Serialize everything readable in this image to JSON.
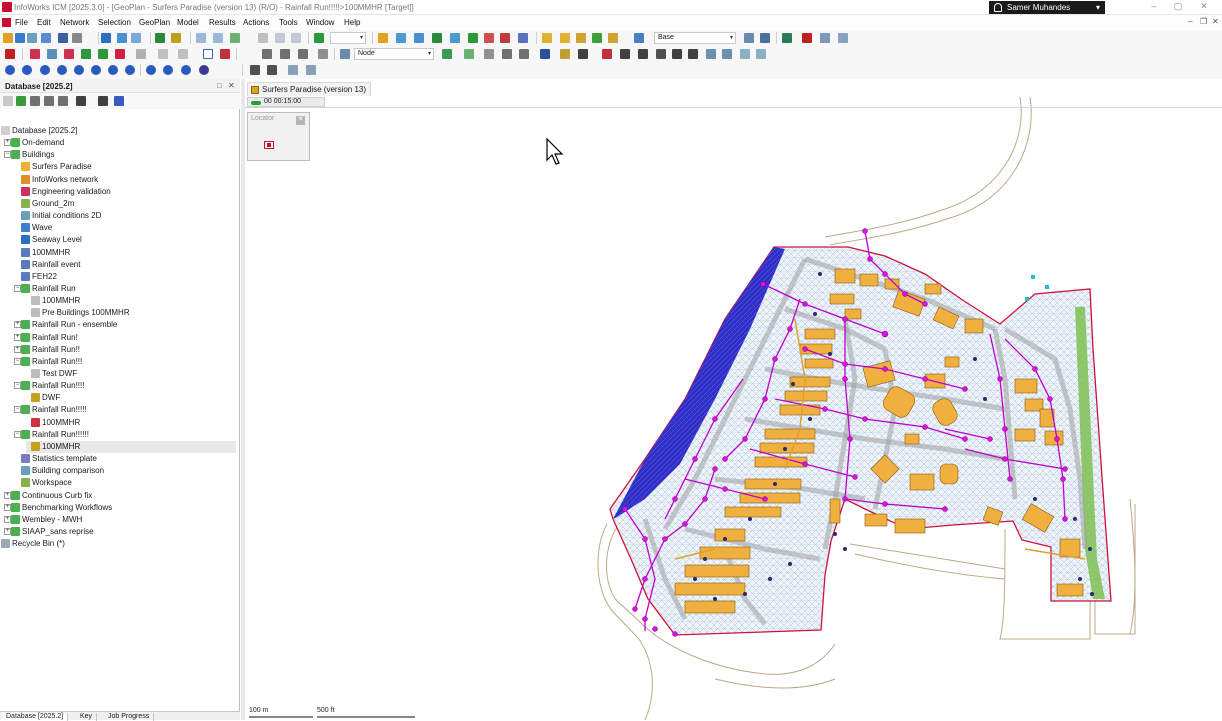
{
  "window": {
    "title": "InfoWorks ICM [2025.3.0] - [GeoPlan - Surfers Paradise (version 13) (R/O) - Rainfall Run!!!!!>100MMHR [Target]]",
    "user": "Samer Muhandes",
    "controls": {
      "minimize": "–",
      "maximize": "▢",
      "close": "✕"
    }
  },
  "menu": {
    "items": [
      "File",
      "Edit",
      "Network",
      "Selection",
      "GeoPlan",
      "Model",
      "Results",
      "Actions",
      "Tools",
      "Window",
      "Help"
    ],
    "mdi_controls": {
      "minimize": "–",
      "restore": "❐",
      "close": "✕"
    }
  },
  "toolbar1": {
    "combo_blank": "",
    "combo_base": "Base"
  },
  "toolbar2": {
    "combo_node": "Node"
  },
  "database_panel": {
    "title": "Database [2025.2]",
    "pin": "□",
    "close": "✕",
    "tree": [
      {
        "label": "Database [2025.2]",
        "level": 0,
        "expander": "",
        "icon_color": "#cfcfcf"
      },
      {
        "label": "On-demand",
        "level": 1,
        "expander": "+",
        "icon_color": "#4caf50"
      },
      {
        "label": "Buildings",
        "level": 1,
        "expander": "−",
        "icon_color": "#4caf50"
      },
      {
        "label": "Surfers Paradise",
        "level": 2,
        "expander": "",
        "icon_color": "#f0b030"
      },
      {
        "label": "InfoWorks network",
        "level": 2,
        "expander": "",
        "icon_color": "#e09020"
      },
      {
        "label": "Engineering validation",
        "level": 2,
        "expander": "",
        "icon_color": "#d03060"
      },
      {
        "label": "Ground_2m",
        "level": 2,
        "expander": "",
        "icon_color": "#8ab04a"
      },
      {
        "label": "Initial conditions 2D",
        "level": 2,
        "expander": "",
        "icon_color": "#6a9fc0"
      },
      {
        "label": "Wave",
        "level": 2,
        "expander": "",
        "icon_color": "#3a80d0"
      },
      {
        "label": "Seaway Level",
        "level": 2,
        "expander": "",
        "icon_color": "#2a70c0"
      },
      {
        "label": "100MMHR",
        "level": 2,
        "expander": "",
        "icon_color": "#5a7ac0"
      },
      {
        "label": "Rainfall event",
        "level": 2,
        "expander": "",
        "icon_color": "#5a7ac0"
      },
      {
        "label": "FEH22",
        "level": 2,
        "expander": "",
        "icon_color": "#5a7ac0"
      },
      {
        "label": "Rainfall Run",
        "level": 2,
        "expander": "−",
        "icon_color": "#4caf50"
      },
      {
        "label": "100MMHR",
        "level": 3,
        "expander": "",
        "icon_color": "#bdbdbd"
      },
      {
        "label": "Pre Buildings 100MMHR",
        "level": 3,
        "expander": "",
        "icon_color": "#bdbdbd"
      },
      {
        "label": "Rainfall Run - ensemble",
        "level": 2,
        "expander": "+",
        "icon_color": "#4caf50"
      },
      {
        "label": "Rainfall Run!",
        "level": 2,
        "expander": "+",
        "icon_color": "#4caf50"
      },
      {
        "label": "Rainfall Run!!",
        "level": 2,
        "expander": "+",
        "icon_color": "#4caf50"
      },
      {
        "label": "Rainfall Run!!!",
        "level": 2,
        "expander": "−",
        "icon_color": "#4caf50"
      },
      {
        "label": "Test DWF",
        "level": 3,
        "expander": "",
        "icon_color": "#bdbdbd"
      },
      {
        "label": "Rainfall Run!!!!",
        "level": 2,
        "expander": "−",
        "icon_color": "#4caf50"
      },
      {
        "label": "DWF",
        "level": 3,
        "expander": "",
        "icon_color": "#c8a020"
      },
      {
        "label": "Rainfall Run!!!!!",
        "level": 2,
        "expander": "−",
        "icon_color": "#4caf50"
      },
      {
        "label": "100MMHR",
        "level": 3,
        "expander": "",
        "icon_color": "#d03040"
      },
      {
        "label": "Rainfall Run!!!!!!",
        "level": 2,
        "expander": "−",
        "icon_color": "#4caf50"
      },
      {
        "label": "100MMHR",
        "level": 3,
        "expander": "",
        "icon_color": "#c8a020",
        "selected": true
      },
      {
        "label": "Statistics template",
        "level": 2,
        "expander": "",
        "icon_color": "#7a7ac0"
      },
      {
        "label": "Building comparison",
        "level": 2,
        "expander": "",
        "icon_color": "#6a9fc0"
      },
      {
        "label": "Workspace",
        "level": 2,
        "expander": "",
        "icon_color": "#8ab04a"
      },
      {
        "label": "Continuous Curb fix",
        "level": 1,
        "expander": "+",
        "icon_color": "#4caf50"
      },
      {
        "label": "Benchmarking Workflows",
        "level": 1,
        "expander": "+",
        "icon_color": "#4caf50"
      },
      {
        "label": "Wembley - MWH",
        "level": 1,
        "expander": "+",
        "icon_color": "#4caf50"
      },
      {
        "label": "SIAAP_sans reprise",
        "level": 1,
        "expander": "+",
        "icon_color": "#4caf50"
      },
      {
        "label": "Recycle Bin (*)",
        "level": 0,
        "expander": "",
        "icon_color": "#9aa9b9"
      }
    ],
    "bottom_tabs": [
      "Database [2025.2]",
      "Key",
      "Job Progress"
    ]
  },
  "geoplan": {
    "tab_label": "Surfers Paradise (version 13)",
    "time": "00 00:15:00",
    "locator_title": "Locator",
    "locator_close": "✕",
    "scale_m": "100 m",
    "scale_ft": "500 ft"
  },
  "colors": {
    "boundary": "#d0103a",
    "pipes": "#c000d0",
    "nodes": "#e010e0",
    "buildings": "#f0b040",
    "roads": "#9a9a9a",
    "sea": "#3a3ad0",
    "green_strip": "#7cc050",
    "mesh": "#7aa8c8",
    "ground_line": "#bca888"
  }
}
